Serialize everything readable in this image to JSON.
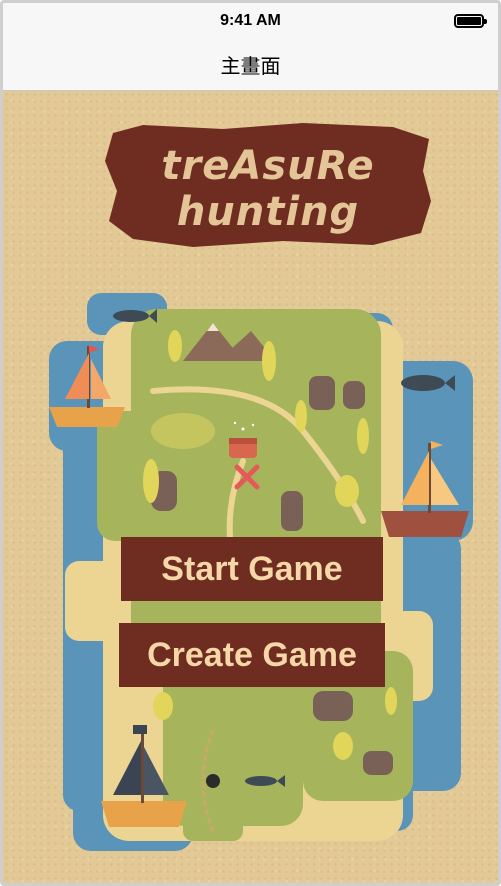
{
  "status_bar": {
    "time": "9:41 AM"
  },
  "nav": {
    "title": "主畫面"
  },
  "title": {
    "line1": "treAsuRe",
    "line2": "hunting"
  },
  "menu": {
    "start_label": "Start Game",
    "create_label": "Create Game"
  },
  "colors": {
    "background": "#e3c996",
    "banner": "#6f2d22",
    "button": "#6f2d22",
    "button_text": "#f6d8a8",
    "water": "#5a94b8",
    "land": "#a6b55b",
    "sand": "#ecd592"
  },
  "icons": [
    "battery-icon",
    "ship-icon",
    "whale-icon",
    "mountain-icon",
    "tree-icon",
    "treasure-chest-icon",
    "x-mark-icon",
    "bomb-icon"
  ]
}
